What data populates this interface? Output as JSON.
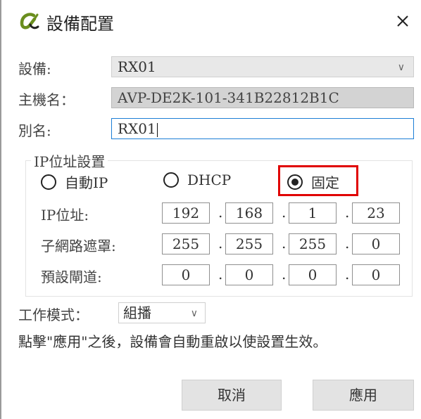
{
  "window": {
    "title": "設備配置",
    "logo_icon": "alpha-logo-icon",
    "close_icon": "close-icon"
  },
  "device": {
    "label": "設備:",
    "value": "RX01"
  },
  "hostname": {
    "label": "主機名：",
    "value": "AVP-DE2K-101-341B22812B1C"
  },
  "alias": {
    "label": "別名:",
    "value": "RX01"
  },
  "ip_settings": {
    "legend": "IP位址設置",
    "modes": [
      {
        "label": "自動IP",
        "selected": false
      },
      {
        "label": "DHCP",
        "selected": false
      },
      {
        "label": "固定",
        "selected": true
      }
    ],
    "ip_address": {
      "label": "IP位址:",
      "octets": [
        "192",
        "168",
        "1",
        "23"
      ]
    },
    "subnet_mask": {
      "label": "子網路遮罩:",
      "octets": [
        "255",
        "255",
        "255",
        "0"
      ]
    },
    "gateway": {
      "label": "預設閘道:",
      "octets": [
        "0",
        "0",
        "0",
        "0"
      ]
    },
    "separator": "."
  },
  "work_mode": {
    "label": "工作模式：",
    "value": "組播"
  },
  "note": "點擊\"應用\"之後，設備會自動重啟以使設置生效。",
  "buttons": {
    "cancel": "取消",
    "apply": "應用"
  },
  "colors": {
    "highlight": "#e00000",
    "focus_border": "#1c7ed6"
  }
}
